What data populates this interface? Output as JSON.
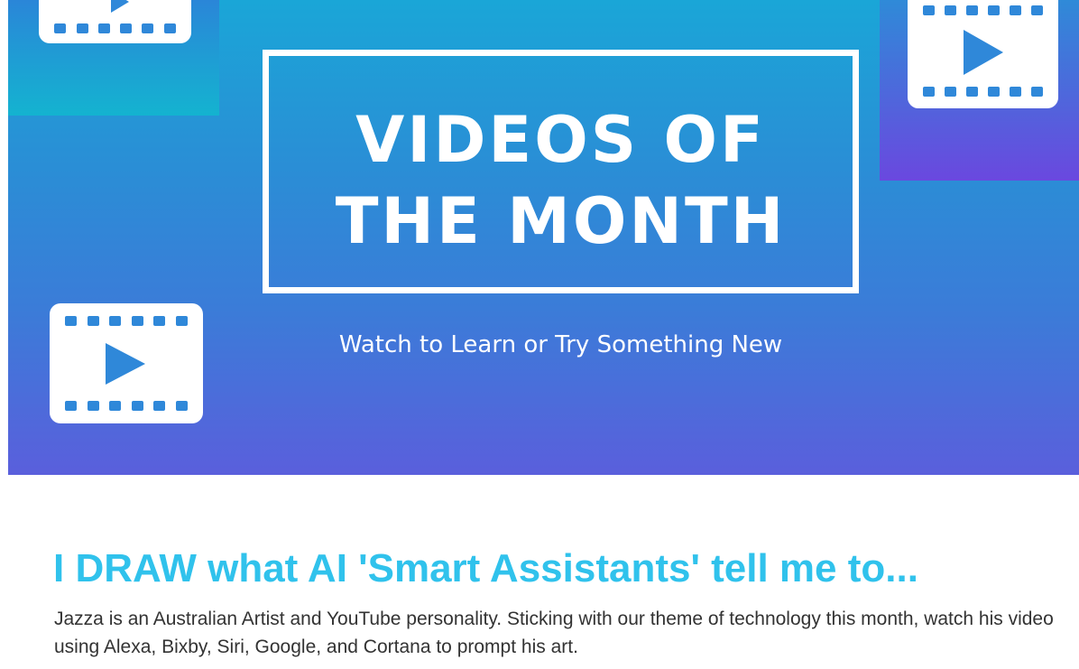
{
  "banner": {
    "title_line1": "VIDEOS OF",
    "title_line2": "THE MONTH",
    "subtitle": "Watch to Learn or Try Something New",
    "icon": "film-play-icon",
    "colors": {
      "gradient_top": "#1aa6d7",
      "gradient_bottom": "#5a5fdc",
      "accent_left": "#14b3d0",
      "accent_right": "#6a48df",
      "icon_blue": "#2f88d9"
    }
  },
  "article": {
    "headline": "I DRAW what AI 'Smart Assistants' tell me to...",
    "body": "Jazza is an Australian Artist and YouTube personality. Sticking with our theme of technology this month, watch his video using Alexa, Bixby, Siri, Google, and Cortana to prompt his art.",
    "colors": {
      "headline": "#30c2ec",
      "body": "#333333"
    }
  }
}
